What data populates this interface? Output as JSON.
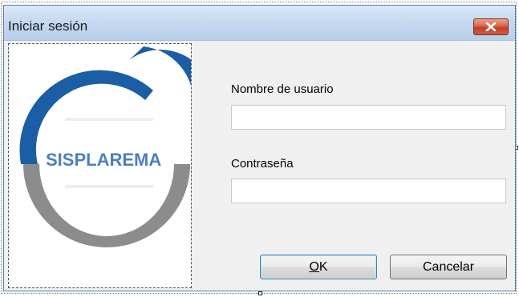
{
  "window": {
    "title": "Iniciar sesión",
    "close_icon": "close-icon"
  },
  "logo": {
    "text": "SISPLAREMA",
    "colors": {
      "blue": "#1b5ea6",
      "gray": "#8a8a8a",
      "text": "#4a80bb"
    }
  },
  "form": {
    "username": {
      "label": "Nombre de usuario",
      "value": ""
    },
    "password": {
      "label": "Contraseña",
      "value": ""
    }
  },
  "buttons": {
    "ok": "OK",
    "cancel": "Cancelar"
  }
}
